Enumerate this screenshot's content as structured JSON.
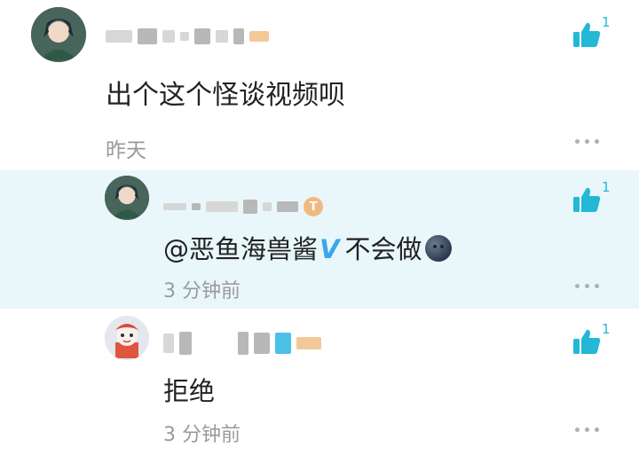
{
  "comments": [
    {
      "text": "出个这个怪谈视频呗",
      "time": "昨天",
      "likes": "1"
    },
    {
      "mention": "@恶鱼海兽酱",
      "verified_mark": "V",
      "text": "不会做",
      "time": "3 分钟前",
      "likes": "1",
      "badge": "T"
    },
    {
      "text": "拒绝",
      "time": "3 分钟前",
      "likes": "1"
    }
  ],
  "colors": {
    "accent": "#22b8d6",
    "highlight_bg": "#e9f7fa",
    "time_gray": "#9a9a9a"
  },
  "icons": [
    "thumbs-up-icon",
    "more-dots-icon",
    "moon-face-icon",
    "verified-v-icon"
  ]
}
